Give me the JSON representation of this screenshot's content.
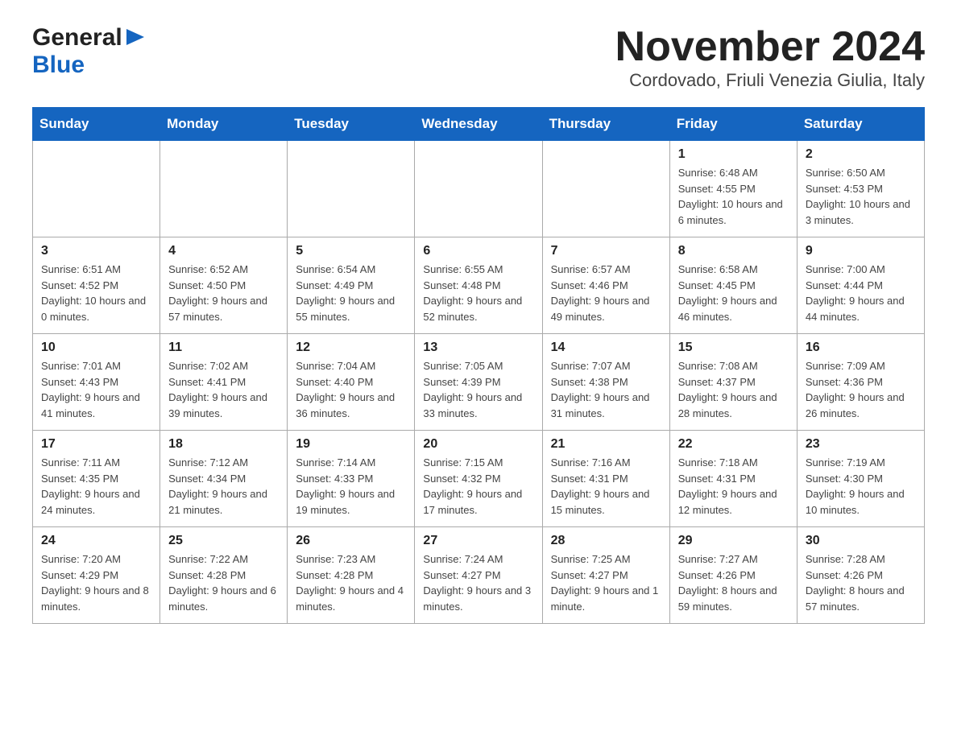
{
  "header": {
    "logo": {
      "general": "General",
      "arrow": "▶",
      "blue": "Blue"
    },
    "title": "November 2024",
    "location": "Cordovado, Friuli Venezia Giulia, Italy"
  },
  "days_of_week": [
    "Sunday",
    "Monday",
    "Tuesday",
    "Wednesday",
    "Thursday",
    "Friday",
    "Saturday"
  ],
  "weeks": [
    [
      {
        "day": "",
        "sunrise": "",
        "sunset": "",
        "daylight": ""
      },
      {
        "day": "",
        "sunrise": "",
        "sunset": "",
        "daylight": ""
      },
      {
        "day": "",
        "sunrise": "",
        "sunset": "",
        "daylight": ""
      },
      {
        "day": "",
        "sunrise": "",
        "sunset": "",
        "daylight": ""
      },
      {
        "day": "",
        "sunrise": "",
        "sunset": "",
        "daylight": ""
      },
      {
        "day": "1",
        "sunrise": "Sunrise: 6:48 AM",
        "sunset": "Sunset: 4:55 PM",
        "daylight": "Daylight: 10 hours and 6 minutes."
      },
      {
        "day": "2",
        "sunrise": "Sunrise: 6:50 AM",
        "sunset": "Sunset: 4:53 PM",
        "daylight": "Daylight: 10 hours and 3 minutes."
      }
    ],
    [
      {
        "day": "3",
        "sunrise": "Sunrise: 6:51 AM",
        "sunset": "Sunset: 4:52 PM",
        "daylight": "Daylight: 10 hours and 0 minutes."
      },
      {
        "day": "4",
        "sunrise": "Sunrise: 6:52 AM",
        "sunset": "Sunset: 4:50 PM",
        "daylight": "Daylight: 9 hours and 57 minutes."
      },
      {
        "day": "5",
        "sunrise": "Sunrise: 6:54 AM",
        "sunset": "Sunset: 4:49 PM",
        "daylight": "Daylight: 9 hours and 55 minutes."
      },
      {
        "day": "6",
        "sunrise": "Sunrise: 6:55 AM",
        "sunset": "Sunset: 4:48 PM",
        "daylight": "Daylight: 9 hours and 52 minutes."
      },
      {
        "day": "7",
        "sunrise": "Sunrise: 6:57 AM",
        "sunset": "Sunset: 4:46 PM",
        "daylight": "Daylight: 9 hours and 49 minutes."
      },
      {
        "day": "8",
        "sunrise": "Sunrise: 6:58 AM",
        "sunset": "Sunset: 4:45 PM",
        "daylight": "Daylight: 9 hours and 46 minutes."
      },
      {
        "day": "9",
        "sunrise": "Sunrise: 7:00 AM",
        "sunset": "Sunset: 4:44 PM",
        "daylight": "Daylight: 9 hours and 44 minutes."
      }
    ],
    [
      {
        "day": "10",
        "sunrise": "Sunrise: 7:01 AM",
        "sunset": "Sunset: 4:43 PM",
        "daylight": "Daylight: 9 hours and 41 minutes."
      },
      {
        "day": "11",
        "sunrise": "Sunrise: 7:02 AM",
        "sunset": "Sunset: 4:41 PM",
        "daylight": "Daylight: 9 hours and 39 minutes."
      },
      {
        "day": "12",
        "sunrise": "Sunrise: 7:04 AM",
        "sunset": "Sunset: 4:40 PM",
        "daylight": "Daylight: 9 hours and 36 minutes."
      },
      {
        "day": "13",
        "sunrise": "Sunrise: 7:05 AM",
        "sunset": "Sunset: 4:39 PM",
        "daylight": "Daylight: 9 hours and 33 minutes."
      },
      {
        "day": "14",
        "sunrise": "Sunrise: 7:07 AM",
        "sunset": "Sunset: 4:38 PM",
        "daylight": "Daylight: 9 hours and 31 minutes."
      },
      {
        "day": "15",
        "sunrise": "Sunrise: 7:08 AM",
        "sunset": "Sunset: 4:37 PM",
        "daylight": "Daylight: 9 hours and 28 minutes."
      },
      {
        "day": "16",
        "sunrise": "Sunrise: 7:09 AM",
        "sunset": "Sunset: 4:36 PM",
        "daylight": "Daylight: 9 hours and 26 minutes."
      }
    ],
    [
      {
        "day": "17",
        "sunrise": "Sunrise: 7:11 AM",
        "sunset": "Sunset: 4:35 PM",
        "daylight": "Daylight: 9 hours and 24 minutes."
      },
      {
        "day": "18",
        "sunrise": "Sunrise: 7:12 AM",
        "sunset": "Sunset: 4:34 PM",
        "daylight": "Daylight: 9 hours and 21 minutes."
      },
      {
        "day": "19",
        "sunrise": "Sunrise: 7:14 AM",
        "sunset": "Sunset: 4:33 PM",
        "daylight": "Daylight: 9 hours and 19 minutes."
      },
      {
        "day": "20",
        "sunrise": "Sunrise: 7:15 AM",
        "sunset": "Sunset: 4:32 PM",
        "daylight": "Daylight: 9 hours and 17 minutes."
      },
      {
        "day": "21",
        "sunrise": "Sunrise: 7:16 AM",
        "sunset": "Sunset: 4:31 PM",
        "daylight": "Daylight: 9 hours and 15 minutes."
      },
      {
        "day": "22",
        "sunrise": "Sunrise: 7:18 AM",
        "sunset": "Sunset: 4:31 PM",
        "daylight": "Daylight: 9 hours and 12 minutes."
      },
      {
        "day": "23",
        "sunrise": "Sunrise: 7:19 AM",
        "sunset": "Sunset: 4:30 PM",
        "daylight": "Daylight: 9 hours and 10 minutes."
      }
    ],
    [
      {
        "day": "24",
        "sunrise": "Sunrise: 7:20 AM",
        "sunset": "Sunset: 4:29 PM",
        "daylight": "Daylight: 9 hours and 8 minutes."
      },
      {
        "day": "25",
        "sunrise": "Sunrise: 7:22 AM",
        "sunset": "Sunset: 4:28 PM",
        "daylight": "Daylight: 9 hours and 6 minutes."
      },
      {
        "day": "26",
        "sunrise": "Sunrise: 7:23 AM",
        "sunset": "Sunset: 4:28 PM",
        "daylight": "Daylight: 9 hours and 4 minutes."
      },
      {
        "day": "27",
        "sunrise": "Sunrise: 7:24 AM",
        "sunset": "Sunset: 4:27 PM",
        "daylight": "Daylight: 9 hours and 3 minutes."
      },
      {
        "day": "28",
        "sunrise": "Sunrise: 7:25 AM",
        "sunset": "Sunset: 4:27 PM",
        "daylight": "Daylight: 9 hours and 1 minute."
      },
      {
        "day": "29",
        "sunrise": "Sunrise: 7:27 AM",
        "sunset": "Sunset: 4:26 PM",
        "daylight": "Daylight: 8 hours and 59 minutes."
      },
      {
        "day": "30",
        "sunrise": "Sunrise: 7:28 AM",
        "sunset": "Sunset: 4:26 PM",
        "daylight": "Daylight: 8 hours and 57 minutes."
      }
    ]
  ]
}
